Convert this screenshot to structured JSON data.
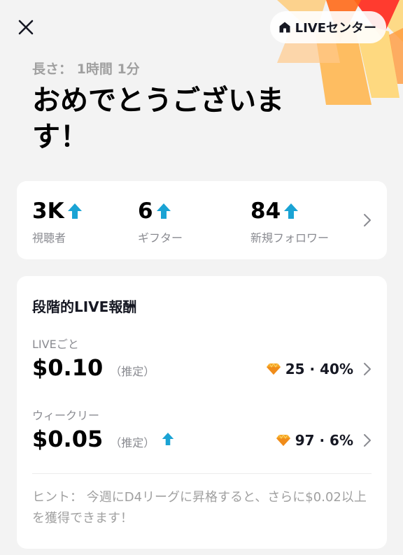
{
  "header": {
    "live_center_label": "LIVEセンター",
    "duration": "長さ： 1時間 1分",
    "headline": "おめでとうございます！"
  },
  "stats": [
    {
      "value": "3K",
      "label": "視聴者",
      "trend": "up"
    },
    {
      "value": "6",
      "label": "ギフター",
      "trend": "up"
    },
    {
      "value": "84",
      "label": "新規フォロワー",
      "trend": "up"
    }
  ],
  "rewards": {
    "title": "段階的LIVE報酬",
    "per_live": {
      "label": "LIVEごと",
      "amount": "$0.10",
      "estimate": "（推定）",
      "summary": "25 · 40%"
    },
    "weekly": {
      "label": "ウィークリー",
      "amount": "$0.05",
      "estimate": "（推定）",
      "summary": "97 · 6%",
      "trend": "up"
    },
    "hint": "ヒント： 今週にD4リーグに昇格すると、さらに$0.02以上を獲得できます！"
  },
  "colors": {
    "trend_arrow": "#1aa3d4",
    "diamond": "#f5a623",
    "burst": [
      "#ff3b2f",
      "#ff6a1a",
      "#ffb347",
      "#ffd36b"
    ]
  },
  "icons": {
    "close": "close-icon",
    "house": "house-icon",
    "trend": "trend-up-arrow-icon",
    "diamond": "diamond-icon",
    "chevron": "chevron-right-icon"
  }
}
